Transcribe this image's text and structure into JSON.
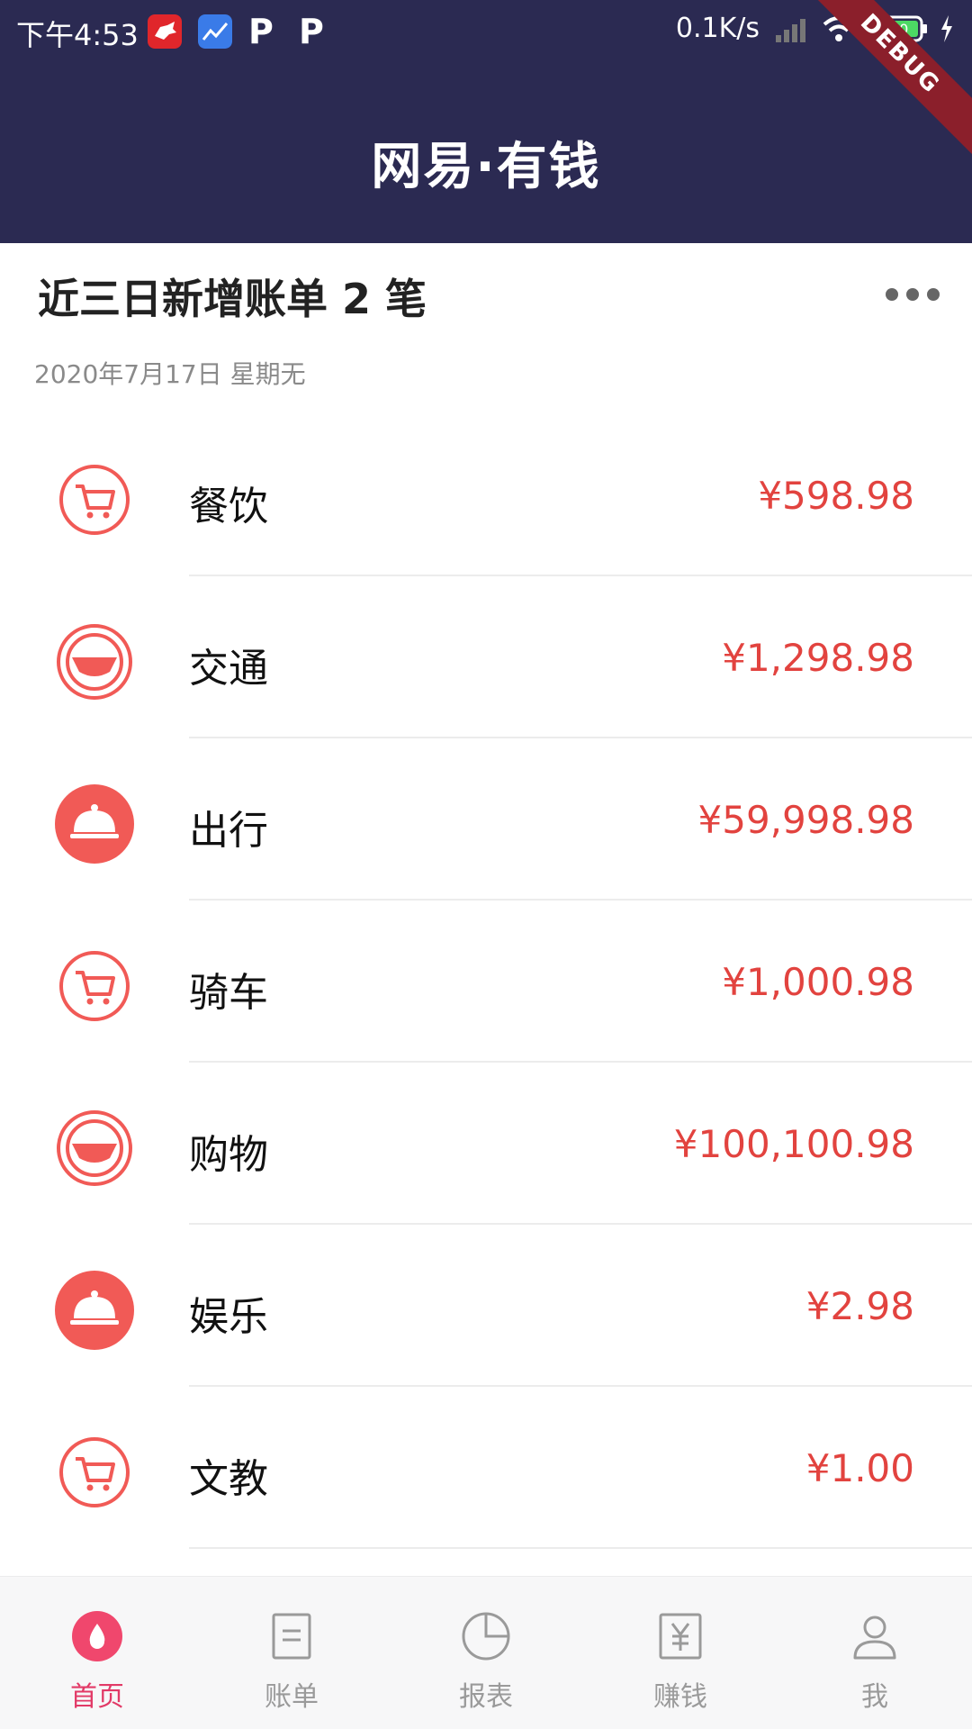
{
  "status_bar": {
    "time": "下午4:53",
    "net_speed": "0.1K/s",
    "battery": "100",
    "debug": "DEBUG",
    "app_p1": "P",
    "app_p2": "P"
  },
  "header": {
    "title": "网易·有钱"
  },
  "summary": {
    "title": "近三日新增账单 2 笔",
    "date": "2020年7月17日 星期无"
  },
  "accent_color": "#e2433f",
  "items": [
    {
      "label": "餐饮",
      "amount": "¥598.98",
      "icon": "shopping-cart-icon"
    },
    {
      "label": "交通",
      "amount": "¥1,298.98",
      "icon": "steering-wheel-icon"
    },
    {
      "label": "出行",
      "amount": "¥59,998.98",
      "icon": "food-cloche-icon"
    },
    {
      "label": "骑车",
      "amount": "¥1,000.98",
      "icon": "shopping-cart-icon"
    },
    {
      "label": "购物",
      "amount": "¥100,100.98",
      "icon": "steering-wheel-icon"
    },
    {
      "label": "娱乐",
      "amount": "¥2.98",
      "icon": "food-cloche-icon"
    },
    {
      "label": "文教",
      "amount": "¥1.00",
      "icon": "shopping-cart-icon"
    }
  ],
  "bottom_nav": [
    {
      "label": "首页",
      "icon": "home-drop-icon",
      "active": true
    },
    {
      "label": "账单",
      "icon": "bill-icon"
    },
    {
      "label": "报表",
      "icon": "pie-chart-icon"
    },
    {
      "label": "赚钱",
      "icon": "yuan-icon"
    },
    {
      "label": "我",
      "icon": "user-icon"
    }
  ]
}
